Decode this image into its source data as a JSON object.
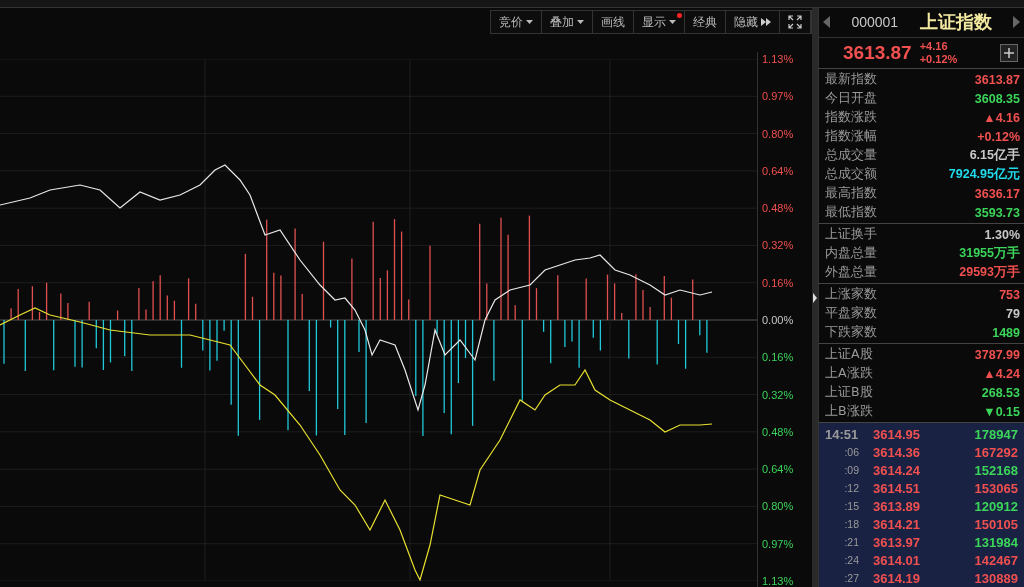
{
  "toolbar": [
    {
      "label": "竞价",
      "dropdown": true,
      "alert": false
    },
    {
      "label": "叠加",
      "dropdown": true,
      "alert": false
    },
    {
      "label": "画线",
      "dropdown": false,
      "alert": false
    },
    {
      "label": "显示",
      "dropdown": true,
      "alert": true
    },
    {
      "label": "经典",
      "dropdown": false,
      "alert": false
    },
    {
      "label": "隐藏",
      "dropdown": false,
      "alert": false
    }
  ],
  "axis_labels": [
    {
      "text": "1.13%",
      "kind": "up"
    },
    {
      "text": "0.97%",
      "kind": "up"
    },
    {
      "text": "0.80%",
      "kind": "up"
    },
    {
      "text": "0.64%",
      "kind": "up"
    },
    {
      "text": "0.48%",
      "kind": "up"
    },
    {
      "text": "0.32%",
      "kind": "up"
    },
    {
      "text": "0.16%",
      "kind": "up"
    },
    {
      "text": "0.00%",
      "kind": "flat"
    },
    {
      "text": "0.16%",
      "kind": "down"
    },
    {
      "text": "0.32%",
      "kind": "down"
    },
    {
      "text": "0.48%",
      "kind": "down"
    },
    {
      "text": "0.64%",
      "kind": "down"
    },
    {
      "text": "0.80%",
      "kind": "down"
    },
    {
      "text": "0.97%",
      "kind": "down"
    },
    {
      "text": "1.13%",
      "kind": "down"
    }
  ],
  "quote": {
    "code": "000001",
    "name": "上证指数",
    "price": "3613.87",
    "change": "+4.16",
    "change_pct": "+0.12%"
  },
  "stat_groups": [
    [
      {
        "label": "最新指数",
        "value": "3613.87",
        "kind": "up"
      },
      {
        "label": "今日开盘",
        "value": "3608.35",
        "kind": "down"
      },
      {
        "label": "指数涨跌",
        "value": "▲4.16",
        "kind": "up"
      },
      {
        "label": "指数涨幅",
        "value": "+0.12%",
        "kind": "up"
      },
      {
        "label": "总成交量",
        "value": "6.15亿手",
        "kind": "flat"
      },
      {
        "label": "总成交额",
        "value": "7924.95亿元",
        "kind": "cyan"
      },
      {
        "label": "最高指数",
        "value": "3636.17",
        "kind": "up"
      },
      {
        "label": "最低指数",
        "value": "3593.73",
        "kind": "down"
      }
    ],
    [
      {
        "label": "上证换手",
        "value": "1.30%",
        "kind": "flat"
      },
      {
        "label": "内盘总量",
        "value": "31955万手",
        "kind": "down"
      },
      {
        "label": "外盘总量",
        "value": "29593万手",
        "kind": "up"
      }
    ],
    [
      {
        "label": "上涨家数",
        "value": "753",
        "kind": "up"
      },
      {
        "label": "平盘家数",
        "value": "79",
        "kind": "flat"
      },
      {
        "label": "下跌家数",
        "value": "1489",
        "kind": "down"
      }
    ],
    [
      {
        "label": "上证A股",
        "value": "3787.99",
        "kind": "up"
      },
      {
        "label": "上A涨跌",
        "value": "▲4.24",
        "kind": "up"
      },
      {
        "label": "上证B股",
        "value": "268.53",
        "kind": "down"
      },
      {
        "label": "上B涨跌",
        "value": "▼0.15",
        "kind": "down"
      }
    ]
  ],
  "ticks": [
    {
      "time": "14:51",
      "price": "3614.95",
      "volume": "178947",
      "kind": "down"
    },
    {
      "time": ":06",
      "price": "3614.36",
      "volume": "167292",
      "kind": "up"
    },
    {
      "time": ":09",
      "price": "3614.24",
      "volume": "152168",
      "kind": "down"
    },
    {
      "time": ":12",
      "price": "3614.51",
      "volume": "153065",
      "kind": "up"
    },
    {
      "time": ":15",
      "price": "3613.89",
      "volume": "120912",
      "kind": "down"
    },
    {
      "time": ":18",
      "price": "3614.21",
      "volume": "150105",
      "kind": "up"
    },
    {
      "time": ":21",
      "price": "3613.97",
      "volume": "131984",
      "kind": "down"
    },
    {
      "time": ":24",
      "price": "3614.01",
      "volume": "142467",
      "kind": "up"
    },
    {
      "time": ":27",
      "price": "3614.19",
      "volume": "130889",
      "kind": "up"
    }
  ]
}
